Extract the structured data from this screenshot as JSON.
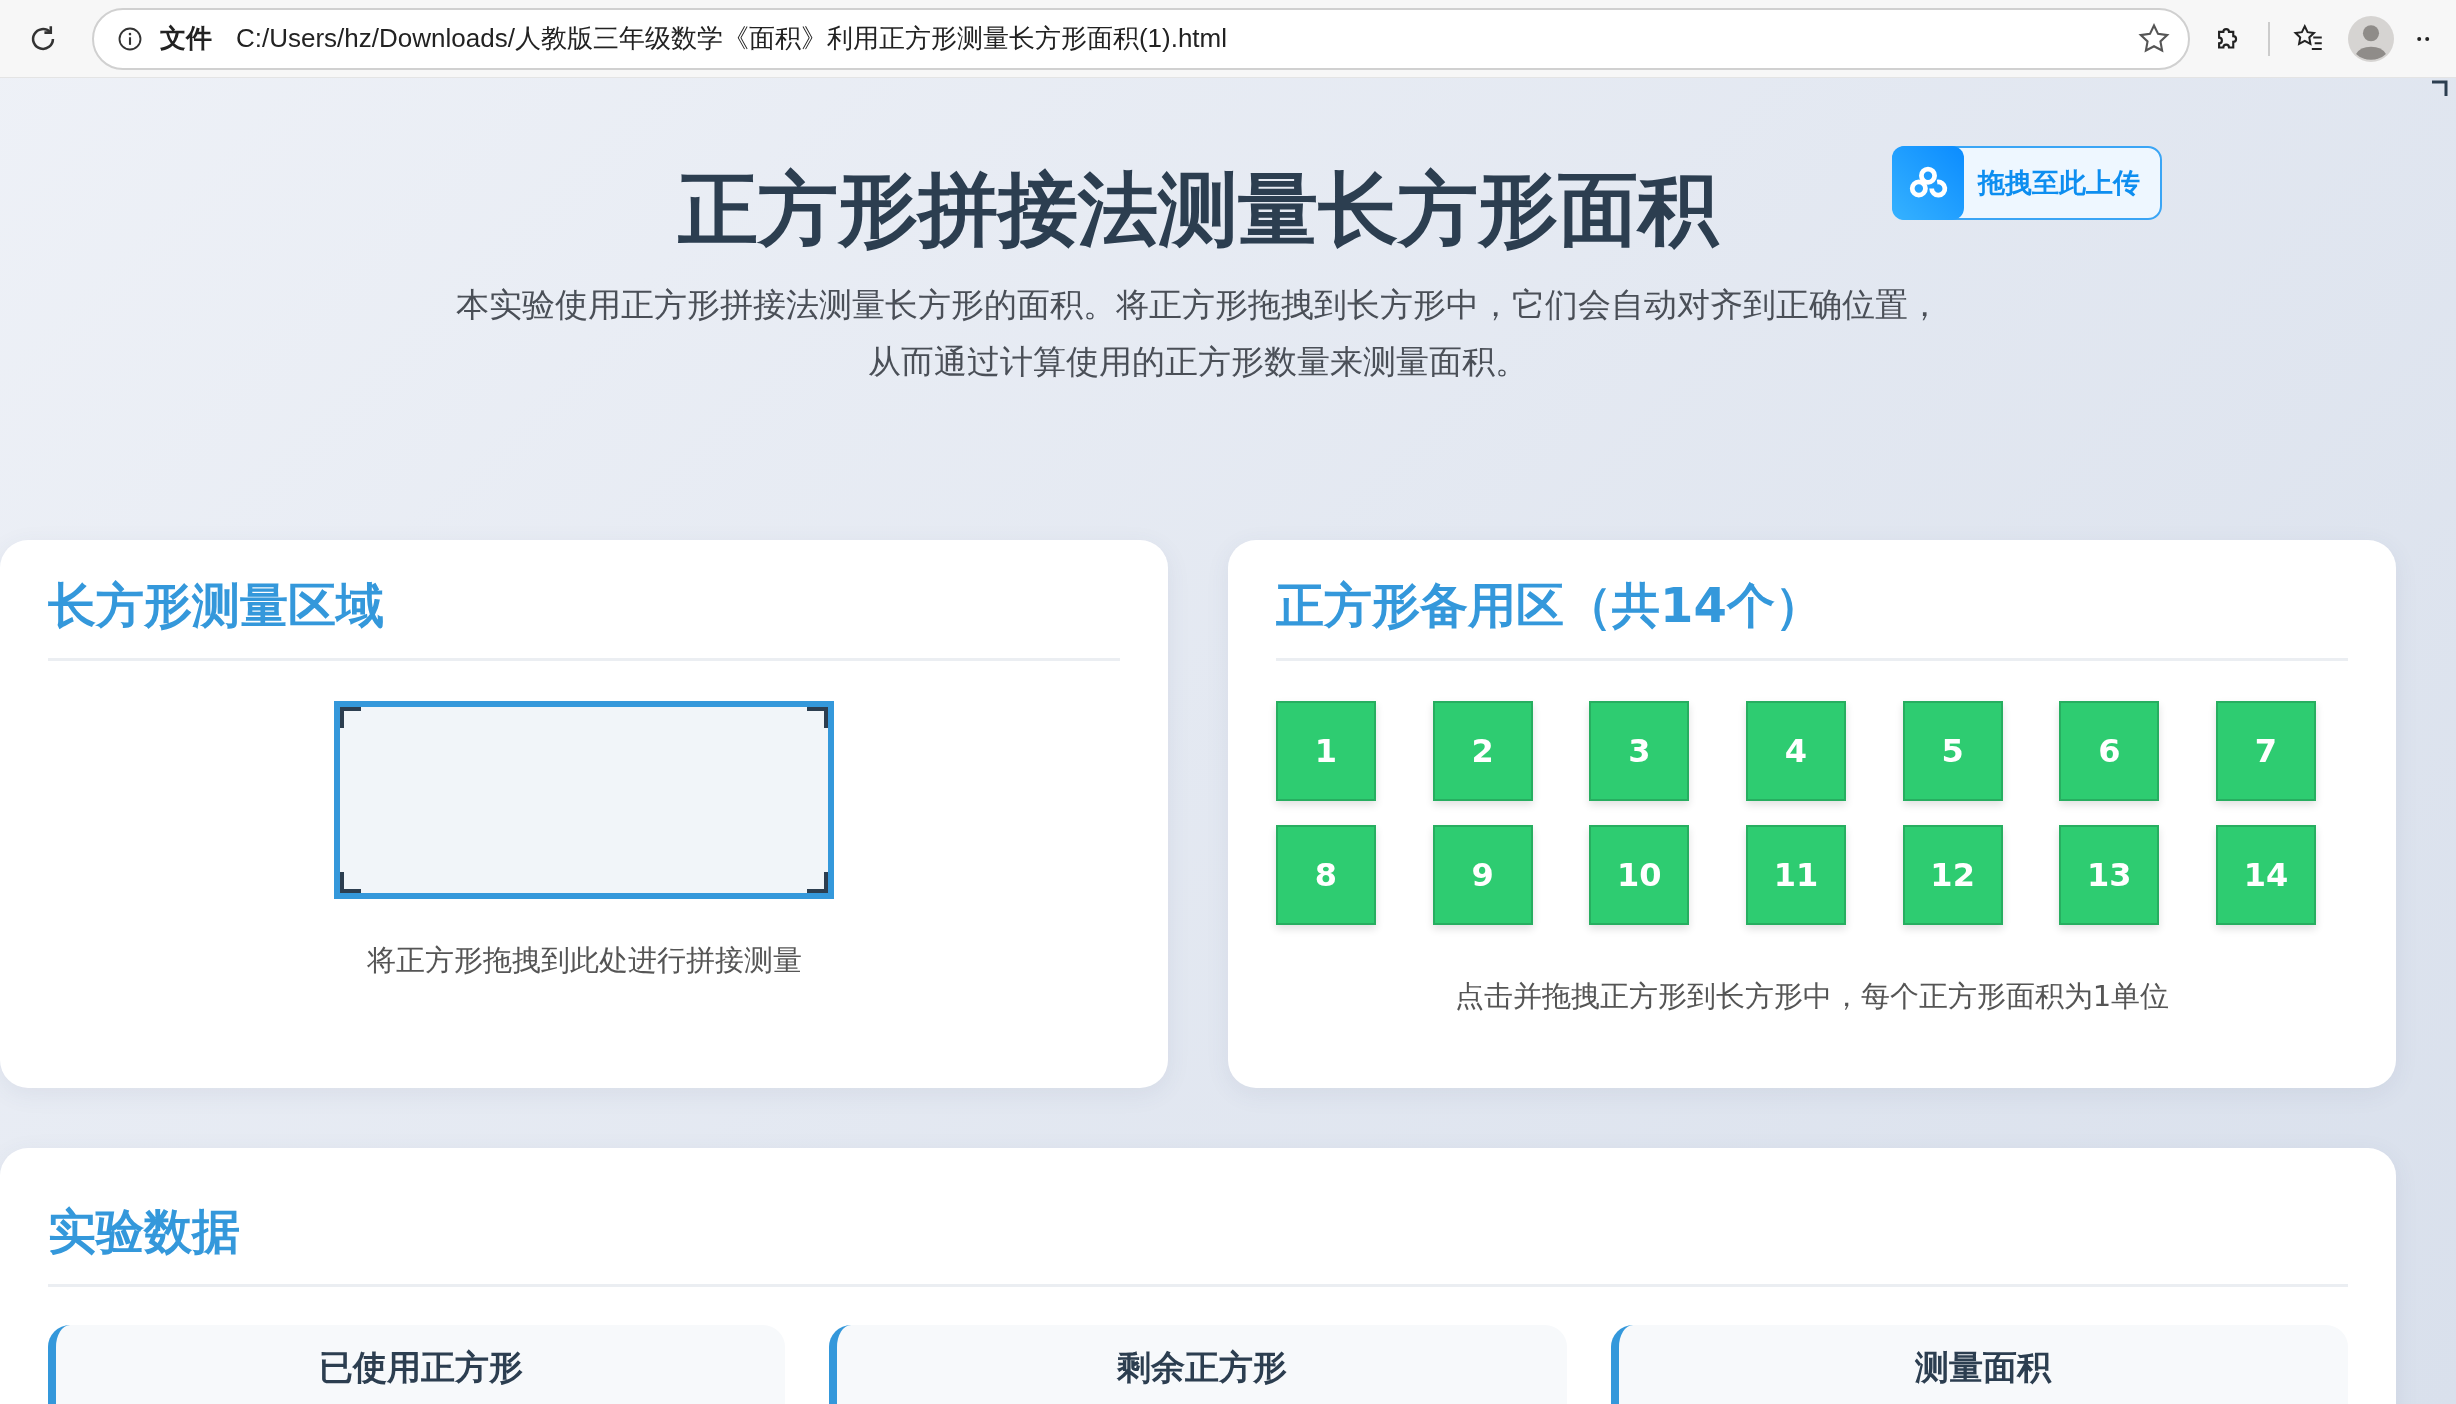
{
  "browser": {
    "label": "文件",
    "url": "C:/Users/hz/Downloads/人教版三年级数学《面积》利用正方形测量长方形面积(1).html"
  },
  "header": {
    "title": "正方形拼接法测量长方形面积",
    "upload_button": "拖拽至此上传",
    "description": [
      "本实验使用正方形拼接法测量长方形的面积。将正方形拖拽到长方形中，它们会自动对齐到正确位置，",
      "从而通过计算使用的正方形数量来测量面积。"
    ]
  },
  "measure_panel": {
    "title": "长方形测量区域",
    "hint": "将正方形拖拽到此处进行拼接测量"
  },
  "squares_panel": {
    "title": "正方形备用区（共14个）",
    "squares": [
      "1",
      "2",
      "3",
      "4",
      "5",
      "6",
      "7",
      "8",
      "9",
      "10",
      "11",
      "12",
      "13",
      "14"
    ],
    "hint": "点击并拖拽正方形到长方形中，每个正方形面积为1单位"
  },
  "data_panel": {
    "title": "实验数据",
    "stats": [
      {
        "label": "已使用正方形"
      },
      {
        "label": "剩余正方形"
      },
      {
        "label": "测量面积"
      }
    ]
  }
}
